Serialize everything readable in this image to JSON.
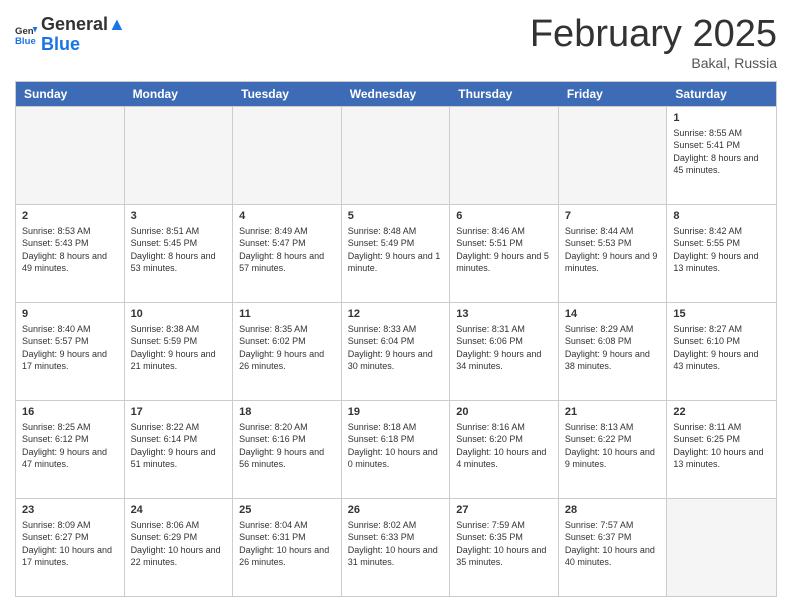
{
  "logo": {
    "line1": "General",
    "line2": "Blue"
  },
  "header": {
    "month_title": "February 2025",
    "location": "Bakal, Russia"
  },
  "days_of_week": [
    "Sunday",
    "Monday",
    "Tuesday",
    "Wednesday",
    "Thursday",
    "Friday",
    "Saturday"
  ],
  "weeks": [
    [
      {
        "day": "",
        "empty": true
      },
      {
        "day": "",
        "empty": true
      },
      {
        "day": "",
        "empty": true
      },
      {
        "day": "",
        "empty": true
      },
      {
        "day": "",
        "empty": true
      },
      {
        "day": "",
        "empty": true
      },
      {
        "day": "1",
        "sunrise": "Sunrise: 8:55 AM",
        "sunset": "Sunset: 5:41 PM",
        "daylight": "Daylight: 8 hours and 45 minutes."
      }
    ],
    [
      {
        "day": "2",
        "sunrise": "Sunrise: 8:53 AM",
        "sunset": "Sunset: 5:43 PM",
        "daylight": "Daylight: 8 hours and 49 minutes."
      },
      {
        "day": "3",
        "sunrise": "Sunrise: 8:51 AM",
        "sunset": "Sunset: 5:45 PM",
        "daylight": "Daylight: 8 hours and 53 minutes."
      },
      {
        "day": "4",
        "sunrise": "Sunrise: 8:49 AM",
        "sunset": "Sunset: 5:47 PM",
        "daylight": "Daylight: 8 hours and 57 minutes."
      },
      {
        "day": "5",
        "sunrise": "Sunrise: 8:48 AM",
        "sunset": "Sunset: 5:49 PM",
        "daylight": "Daylight: 9 hours and 1 minute."
      },
      {
        "day": "6",
        "sunrise": "Sunrise: 8:46 AM",
        "sunset": "Sunset: 5:51 PM",
        "daylight": "Daylight: 9 hours and 5 minutes."
      },
      {
        "day": "7",
        "sunrise": "Sunrise: 8:44 AM",
        "sunset": "Sunset: 5:53 PM",
        "daylight": "Daylight: 9 hours and 9 minutes."
      },
      {
        "day": "8",
        "sunrise": "Sunrise: 8:42 AM",
        "sunset": "Sunset: 5:55 PM",
        "daylight": "Daylight: 9 hours and 13 minutes."
      }
    ],
    [
      {
        "day": "9",
        "sunrise": "Sunrise: 8:40 AM",
        "sunset": "Sunset: 5:57 PM",
        "daylight": "Daylight: 9 hours and 17 minutes."
      },
      {
        "day": "10",
        "sunrise": "Sunrise: 8:38 AM",
        "sunset": "Sunset: 5:59 PM",
        "daylight": "Daylight: 9 hours and 21 minutes."
      },
      {
        "day": "11",
        "sunrise": "Sunrise: 8:35 AM",
        "sunset": "Sunset: 6:02 PM",
        "daylight": "Daylight: 9 hours and 26 minutes."
      },
      {
        "day": "12",
        "sunrise": "Sunrise: 8:33 AM",
        "sunset": "Sunset: 6:04 PM",
        "daylight": "Daylight: 9 hours and 30 minutes."
      },
      {
        "day": "13",
        "sunrise": "Sunrise: 8:31 AM",
        "sunset": "Sunset: 6:06 PM",
        "daylight": "Daylight: 9 hours and 34 minutes."
      },
      {
        "day": "14",
        "sunrise": "Sunrise: 8:29 AM",
        "sunset": "Sunset: 6:08 PM",
        "daylight": "Daylight: 9 hours and 38 minutes."
      },
      {
        "day": "15",
        "sunrise": "Sunrise: 8:27 AM",
        "sunset": "Sunset: 6:10 PM",
        "daylight": "Daylight: 9 hours and 43 minutes."
      }
    ],
    [
      {
        "day": "16",
        "sunrise": "Sunrise: 8:25 AM",
        "sunset": "Sunset: 6:12 PM",
        "daylight": "Daylight: 9 hours and 47 minutes."
      },
      {
        "day": "17",
        "sunrise": "Sunrise: 8:22 AM",
        "sunset": "Sunset: 6:14 PM",
        "daylight": "Daylight: 9 hours and 51 minutes."
      },
      {
        "day": "18",
        "sunrise": "Sunrise: 8:20 AM",
        "sunset": "Sunset: 6:16 PM",
        "daylight": "Daylight: 9 hours and 56 minutes."
      },
      {
        "day": "19",
        "sunrise": "Sunrise: 8:18 AM",
        "sunset": "Sunset: 6:18 PM",
        "daylight": "Daylight: 10 hours and 0 minutes."
      },
      {
        "day": "20",
        "sunrise": "Sunrise: 8:16 AM",
        "sunset": "Sunset: 6:20 PM",
        "daylight": "Daylight: 10 hours and 4 minutes."
      },
      {
        "day": "21",
        "sunrise": "Sunrise: 8:13 AM",
        "sunset": "Sunset: 6:22 PM",
        "daylight": "Daylight: 10 hours and 9 minutes."
      },
      {
        "day": "22",
        "sunrise": "Sunrise: 8:11 AM",
        "sunset": "Sunset: 6:25 PM",
        "daylight": "Daylight: 10 hours and 13 minutes."
      }
    ],
    [
      {
        "day": "23",
        "sunrise": "Sunrise: 8:09 AM",
        "sunset": "Sunset: 6:27 PM",
        "daylight": "Daylight: 10 hours and 17 minutes."
      },
      {
        "day": "24",
        "sunrise": "Sunrise: 8:06 AM",
        "sunset": "Sunset: 6:29 PM",
        "daylight": "Daylight: 10 hours and 22 minutes."
      },
      {
        "day": "25",
        "sunrise": "Sunrise: 8:04 AM",
        "sunset": "Sunset: 6:31 PM",
        "daylight": "Daylight: 10 hours and 26 minutes."
      },
      {
        "day": "26",
        "sunrise": "Sunrise: 8:02 AM",
        "sunset": "Sunset: 6:33 PM",
        "daylight": "Daylight: 10 hours and 31 minutes."
      },
      {
        "day": "27",
        "sunrise": "Sunrise: 7:59 AM",
        "sunset": "Sunset: 6:35 PM",
        "daylight": "Daylight: 10 hours and 35 minutes."
      },
      {
        "day": "28",
        "sunrise": "Sunrise: 7:57 AM",
        "sunset": "Sunset: 6:37 PM",
        "daylight": "Daylight: 10 hours and 40 minutes."
      },
      {
        "day": "",
        "empty": true
      }
    ]
  ]
}
